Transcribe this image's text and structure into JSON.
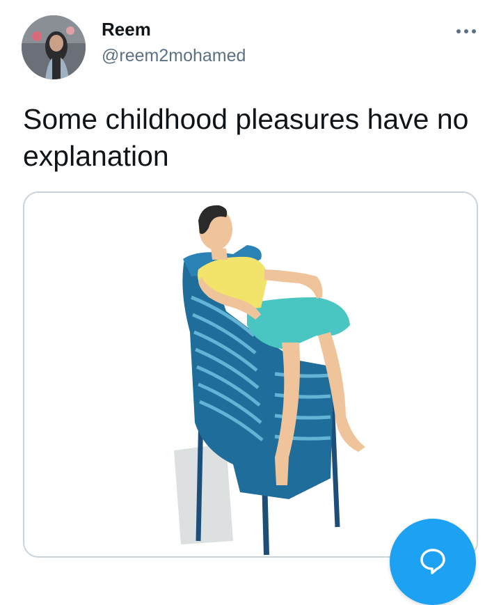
{
  "tweet": {
    "author": {
      "name": "Reem",
      "handle": "@reem2mohamed",
      "avatar_icon": "profile-photo"
    },
    "text": "Some childhood pleasures have no explanation",
    "media": {
      "kind": "illustration",
      "subject": "man-sitting-on-stacked-blue-chairs"
    }
  },
  "controls": {
    "more_icon": "more-horizontal-icon",
    "compose_icon": "speech-bubble-icon"
  },
  "colors": {
    "accent": "#1da1f2",
    "text_primary": "#0f1419",
    "text_secondary": "#5b7083",
    "border": "#c9d4dc"
  }
}
